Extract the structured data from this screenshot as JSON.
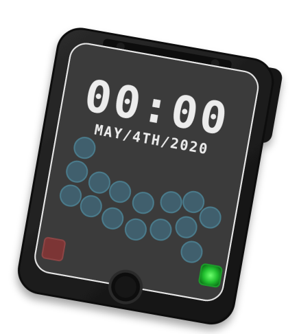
{
  "device": {
    "clock": {
      "time": "00:00",
      "date": "MAY/4TH/2020"
    },
    "colors": {
      "body": "#1c1c1c",
      "screen": "#3a3a3a",
      "screen_border": "#e6e6e6",
      "clock_text": "#e9e9e9",
      "dot_fill": "#3f5f6d",
      "dot_stroke": "#4b7c8c",
      "red_button": "#7a3535",
      "green_button": "#2fd43f"
    },
    "dots_count": 15,
    "icons": {
      "left_button": "red-square-button",
      "right_button": "green-square-button",
      "home_button": "round-home-button",
      "antenna": "antenna"
    }
  }
}
